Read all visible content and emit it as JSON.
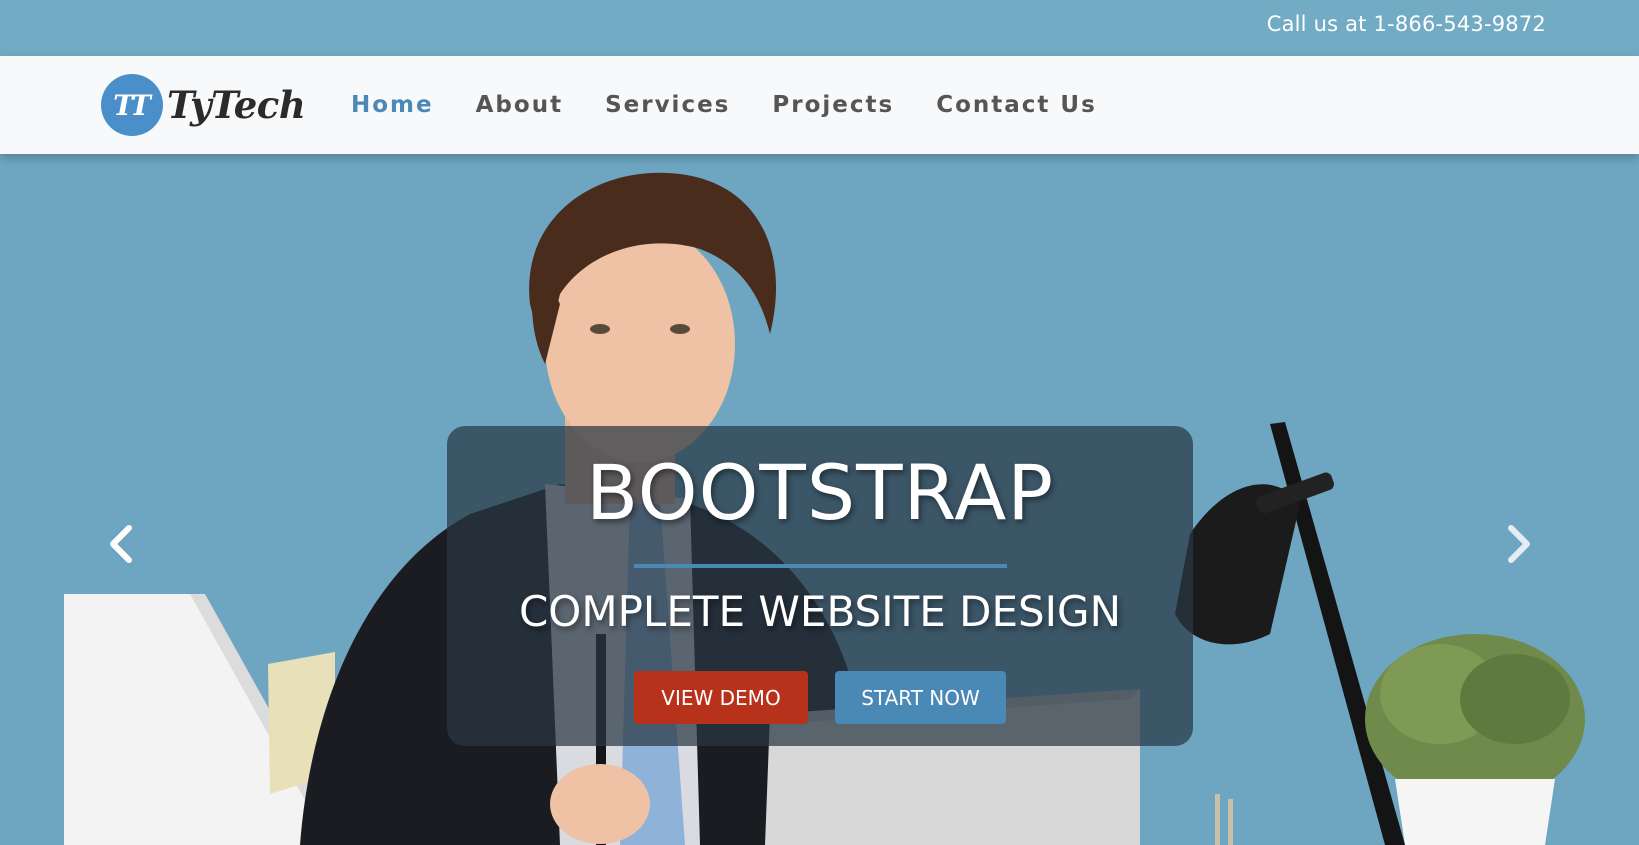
{
  "topbar": {
    "phone_text": "Call us at 1-866-543-9872"
  },
  "brand": {
    "logo_mark": "TT",
    "logo_text": "TyTech",
    "logo_color": "#4a8fc9"
  },
  "nav": {
    "items": [
      {
        "label": "Home",
        "active": true
      },
      {
        "label": "About",
        "active": false
      },
      {
        "label": "Services",
        "active": false
      },
      {
        "label": "Projects",
        "active": false
      },
      {
        "label": "Contact Us",
        "active": false
      }
    ]
  },
  "hero": {
    "title": "BOOTSTRAP",
    "subtitle": "COMPLETE WEBSITE DESIGN",
    "buttons": {
      "demo_label": "VIEW DEMO",
      "start_label": "START NOW"
    },
    "prev_icon": "chevron-left-icon",
    "next_icon": "chevron-right-icon"
  },
  "colors": {
    "topbar_bg": "#72abc4",
    "accent": "#4a88b5",
    "demo_button": "#b8311a",
    "nav_text": "#555555"
  }
}
